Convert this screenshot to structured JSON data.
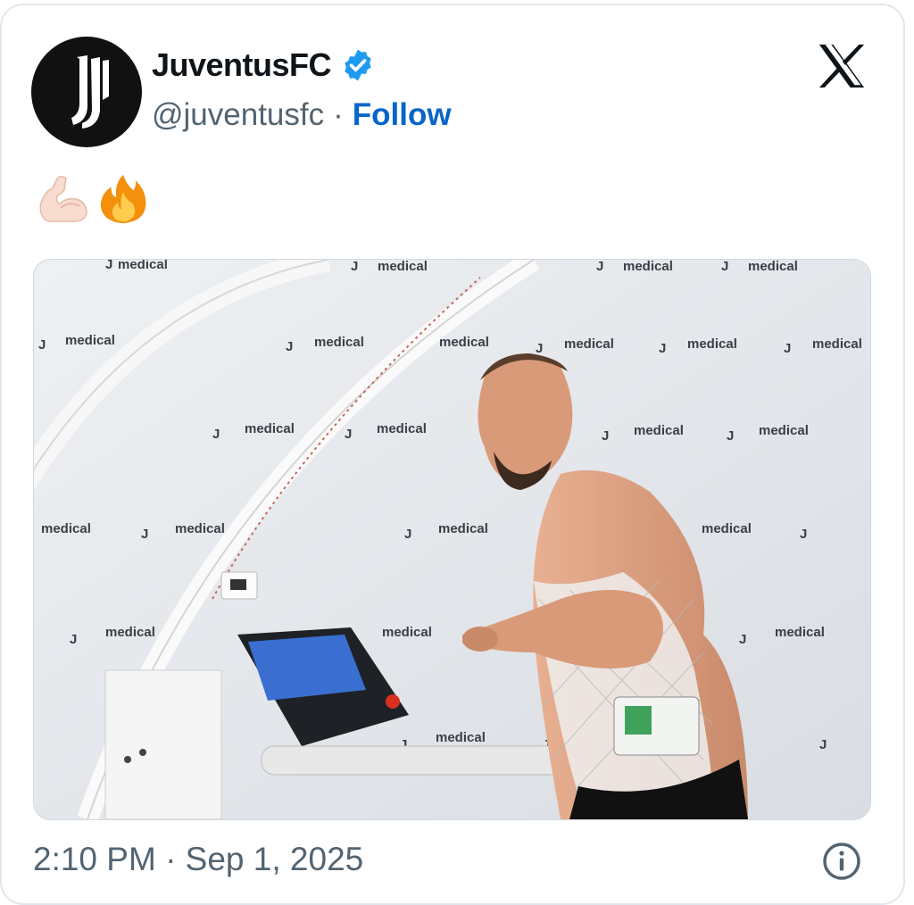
{
  "tweet": {
    "author": {
      "display_name": "JuventusFC",
      "handle": "@juventusfc",
      "verified": true,
      "avatar_icon": "juventus-j-logo-icon"
    },
    "separator": "·",
    "follow_label": "Follow",
    "text_emojis": [
      "💪🏻",
      "🔥"
    ],
    "media": {
      "watermark_text": "medical",
      "watermark_logo": "J"
    },
    "timestamp": "2:10 PM · Sep 1, 2025"
  },
  "icons": {
    "platform": "x-logo-icon",
    "verified": "verified-badge-icon",
    "info": "info-icon"
  },
  "colors": {
    "follow": "#0866c9",
    "verified": "#1d9bf0",
    "secondary_text": "#536471",
    "primary_text": "#0f1419"
  }
}
